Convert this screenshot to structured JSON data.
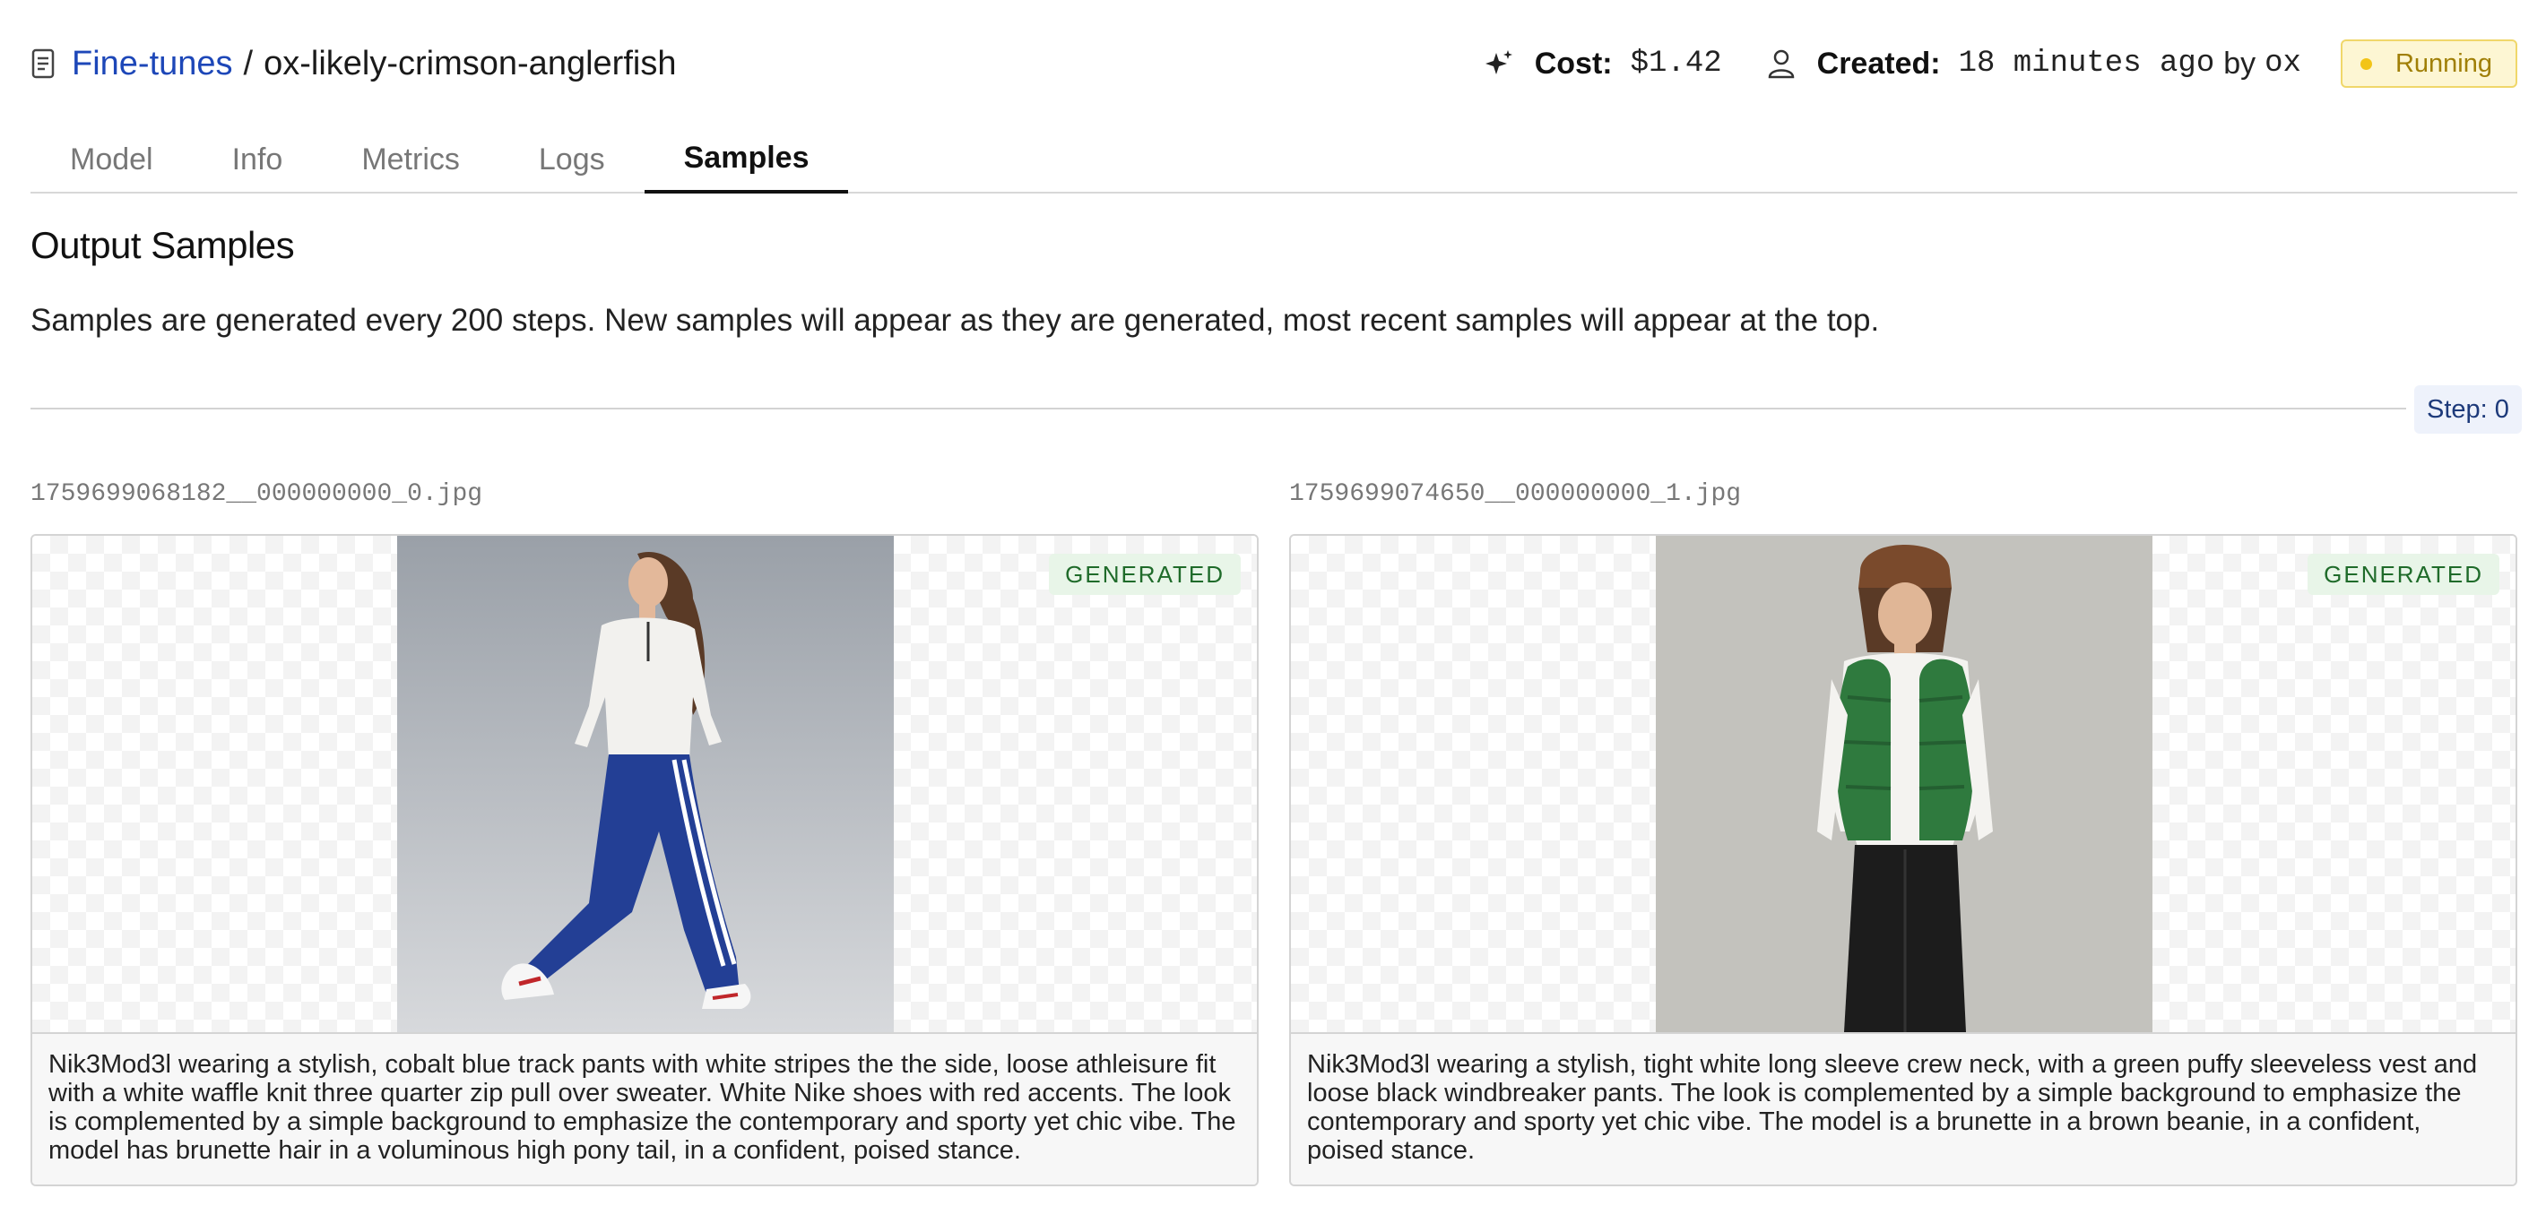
{
  "breadcrumb": {
    "parent": "Fine-tunes",
    "separator": "/",
    "current": "ox-likely-crimson-anglerfish"
  },
  "meta": {
    "cost_label": "Cost:",
    "cost_value": "$1.42",
    "created_label": "Created:",
    "created_value": "18 minutes ago",
    "by_text": "by",
    "user": "ox",
    "status": "Running"
  },
  "tabs": [
    {
      "label": "Model",
      "active": false
    },
    {
      "label": "Info",
      "active": false
    },
    {
      "label": "Metrics",
      "active": false
    },
    {
      "label": "Logs",
      "active": false
    },
    {
      "label": "Samples",
      "active": true
    }
  ],
  "section": {
    "title": "Output Samples",
    "description": "Samples are generated every 200 steps. New samples will appear as they are generated, most recent samples will appear at the top.",
    "step_label": "Step: 0"
  },
  "samples": [
    {
      "filename": "1759699068182__000000000_0.jpg",
      "badge": "GENERATED",
      "caption": "Nik3Mod3l wearing a stylish, cobalt blue track pants with white stripes the the side, loose athleisure fit with a white waffle knit three quarter zip pull over sweater. White Nike shoes with red accents. The look is complemented by a simple background to emphasize the contemporary and sporty yet chic vibe. The model has brunette hair in a voluminous high pony tail, in a confident, poised stance."
    },
    {
      "filename": "1759699074650__000000000_1.jpg",
      "badge": "GENERATED",
      "caption": "Nik3Mod3l wearing a stylish, tight white long sleeve crew neck, with a green puffy sleeveless vest and loose black windbreaker pants. The look is complemented by a simple background to emphasize the contemporary and sporty yet chic vibe. The model is a brunette in a brown beanie, in a confident, poised stance."
    }
  ],
  "colors": {
    "link": "#1d47b8",
    "running_bg": "#fdf6d3",
    "running_text": "#a07f07",
    "generated_bg": "#e8f5e8",
    "generated_text": "#1f6b2a"
  },
  "icons": {
    "breadcrumb": "document-icon",
    "cost": "sparkle-icon",
    "created": "user-icon"
  }
}
